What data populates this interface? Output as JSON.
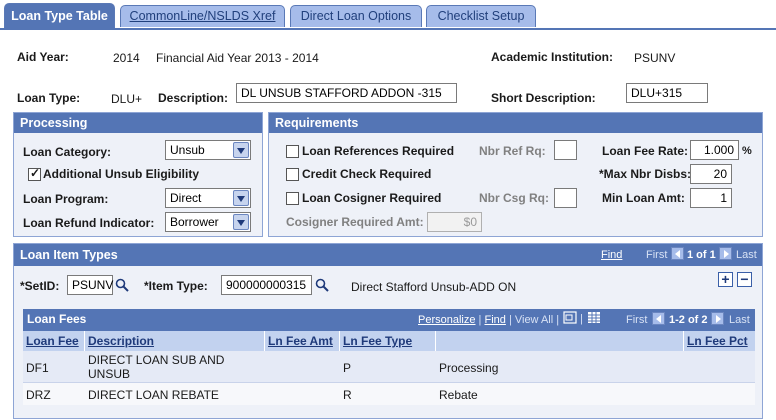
{
  "tabs": [
    "Loan Type Table",
    "CommonLine/NSLDS Xref",
    "Direct Loan Options",
    "Checklist Setup"
  ],
  "header": {
    "aid_year_label": "Aid Year:",
    "aid_year": "2014",
    "aid_year_desc": "Financial Aid Year 2013 - 2014",
    "institution_label": "Academic Institution:",
    "institution": "PSUNV",
    "loan_type_label": "Loan Type:",
    "loan_type": "DLU+",
    "description_label": "Description:",
    "description": "DL UNSUB STAFFORD ADDON -315",
    "short_desc_label": "Short Description:",
    "short_desc": "DLU+315"
  },
  "processing": {
    "title": "Processing",
    "loan_category_label": "Loan Category:",
    "loan_category": "Unsub",
    "additional_unsub_label": "Additional Unsub Eligibility",
    "additional_unsub_checked": true,
    "loan_program_label": "Loan Program:",
    "loan_program": "Direct",
    "refund_label": "Loan Refund Indicator:",
    "refund": "Borrower"
  },
  "requirements": {
    "title": "Requirements",
    "loan_refs_label": "Loan References Required",
    "credit_check_label": "Credit Check Required",
    "cosigner_label": "Loan Cosigner Required",
    "nbr_ref_label": "Nbr Ref Rq:",
    "nbr_csg_label": "Nbr Csg Rq:",
    "cosigner_amt_label": "Cosigner Required Amt:",
    "cosigner_amt": "$0",
    "fee_rate_label": "Loan Fee Rate:",
    "fee_rate": "1.000",
    "fee_rate_unit": "%",
    "max_disbs_label": "*Max Nbr Disbs:",
    "max_disbs": "20",
    "min_loan_label": "Min Loan Amt:",
    "min_loan": "1"
  },
  "loan_item_types": {
    "title": "Loan Item Types",
    "find": "Find",
    "nav_first": "First",
    "nav_count": "1 of 1",
    "nav_last": "Last",
    "setid_label": "*SetID:",
    "setid": "PSUNV",
    "item_type_label": "*Item Type:",
    "item_type": "900000000315",
    "item_type_desc": "Direct Stafford Unsub-ADD ON"
  },
  "loan_fees": {
    "title": "Loan Fees",
    "personalize": "Personalize",
    "find": "Find",
    "view_all": "View All",
    "nav_first": "First",
    "nav_count": "1-2 of 2",
    "nav_last": "Last",
    "columns": [
      "Loan Fee",
      "Description",
      "Ln Fee Amt",
      "Ln Fee Type",
      "",
      "Ln Fee Pct"
    ],
    "rows": [
      [
        "DF1",
        "DIRECT LOAN SUB AND UNSUB",
        "",
        "P",
        "Processing",
        ""
      ],
      [
        "DRZ",
        "DIRECT LOAN REBATE",
        "",
        "R",
        "Rebate",
        ""
      ]
    ]
  }
}
